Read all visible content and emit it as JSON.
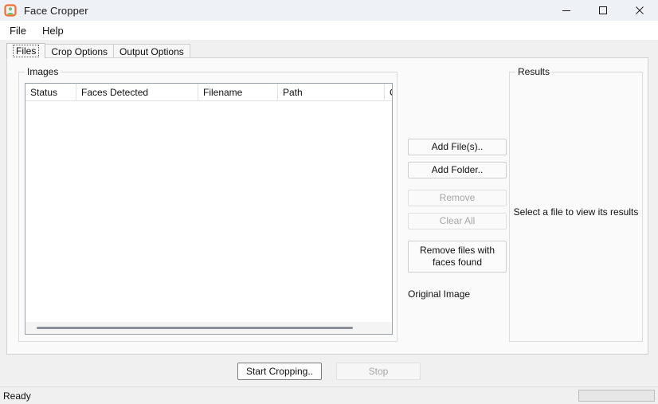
{
  "window": {
    "title": "Face Cropper",
    "icon": "face-cropper-app-icon",
    "controls": {
      "minimize": "minimize-icon",
      "maximize": "maximize-icon",
      "close": "close-icon"
    }
  },
  "menubar": {
    "items": [
      {
        "label": "File"
      },
      {
        "label": "Help"
      }
    ]
  },
  "tabs": [
    {
      "label": "Files",
      "selected": true
    },
    {
      "label": "Crop Options",
      "selected": false
    },
    {
      "label": "Output Options",
      "selected": false
    }
  ],
  "images_group": {
    "title": "Images",
    "columns": [
      {
        "label": "Status"
      },
      {
        "label": "Faces Detected"
      },
      {
        "label": "Filename"
      },
      {
        "label": "Path"
      },
      {
        "label": "Ou"
      }
    ],
    "rows": []
  },
  "buttons": {
    "add_files": "Add File(s)..",
    "add_folder": "Add Folder..",
    "remove": "Remove",
    "clear_all": "Clear All",
    "remove_faces_found": "Remove files with faces found"
  },
  "preview": {
    "label": "Original Image"
  },
  "results_group": {
    "title": "Results",
    "placeholder": "Select a file to view its results"
  },
  "actions": {
    "start": "Start Cropping..",
    "stop": "Stop"
  },
  "statusbar": {
    "text": "Ready",
    "progress": 0
  },
  "colors": {
    "titlebar": "#eef2f7",
    "panel": "#fafafa",
    "window_bg": "#f0f0f0",
    "icon_orange": "#ef7030",
    "icon_green": "#6fbf73",
    "scroll_thumb": "#888f96"
  }
}
